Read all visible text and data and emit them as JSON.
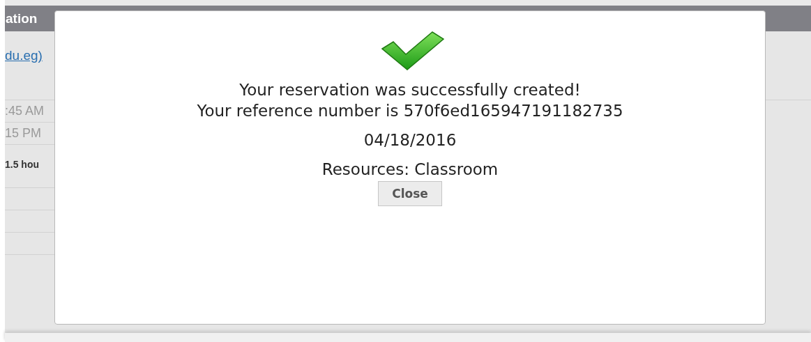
{
  "background": {
    "header": "ation",
    "link": "du.eg)",
    "rows": [
      {
        "kind": "time",
        "text": ":45 AM"
      },
      {
        "kind": "time",
        "text": "15 PM"
      },
      {
        "kind": "duration",
        "text": "1.5 hou"
      },
      {
        "kind": "empty"
      },
      {
        "kind": "empty"
      },
      {
        "kind": "empty"
      }
    ]
  },
  "dialog": {
    "message": [
      "Your reservation was successfully created!",
      "Your reference number is 570f6ed165947191182735"
    ],
    "date": "04/18/2016",
    "resources": "Resources: Classroom",
    "close_button": "Close"
  }
}
